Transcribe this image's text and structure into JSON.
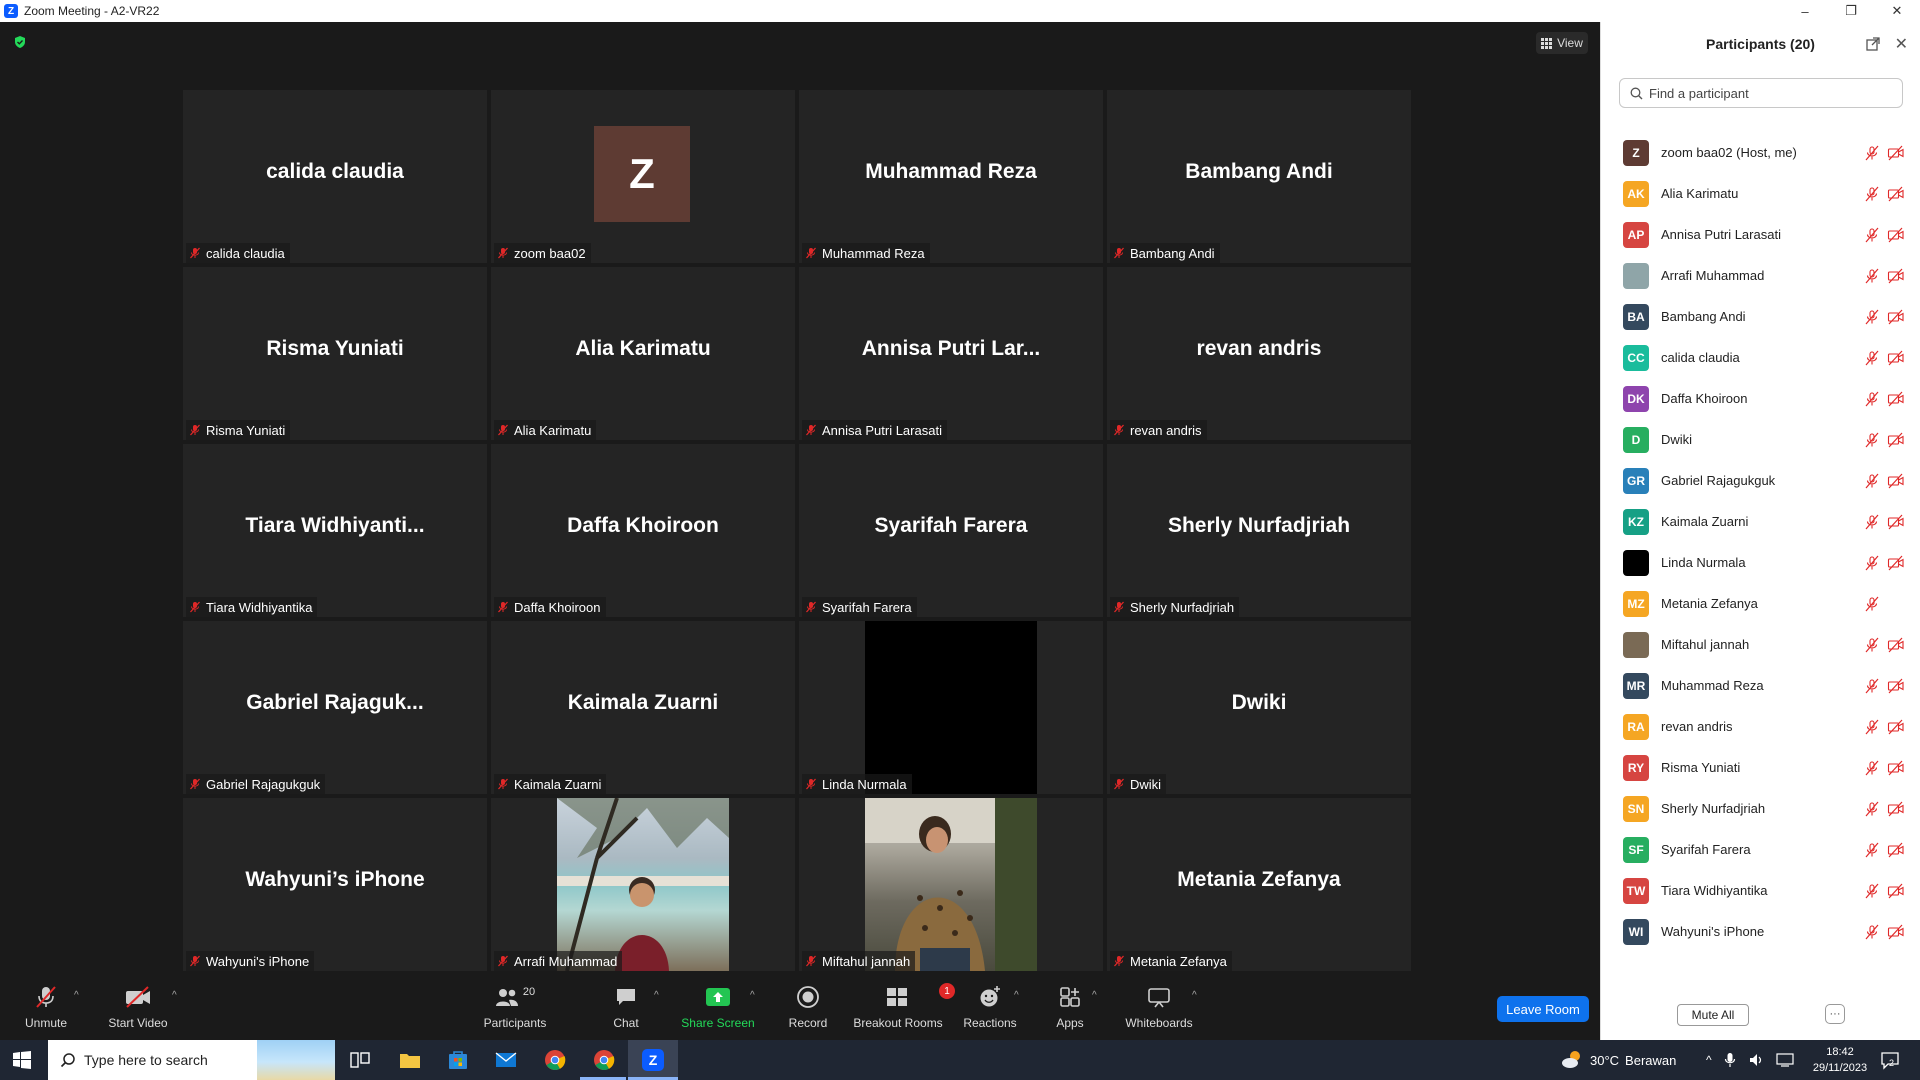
{
  "window": {
    "title": "Zoom Meeting - A2-VR22",
    "logo_letter": "Z",
    "controls": [
      "–",
      "❐",
      "✕"
    ]
  },
  "main": {
    "view_label": "View",
    "tiles": [
      {
        "big": "calida claudia",
        "label": "calida claudia",
        "kind": "name"
      },
      {
        "big": "",
        "label": "zoom baa02",
        "kind": "avatar",
        "avatar": "Z"
      },
      {
        "big": "Muhammad Reza",
        "label": "Muhammad Reza",
        "kind": "name"
      },
      {
        "big": "Bambang Andi",
        "label": "Bambang Andi",
        "kind": "name"
      },
      {
        "big": "Risma Yuniati",
        "label": "Risma Yuniati",
        "kind": "name"
      },
      {
        "big": "Alia Karimatu",
        "label": "Alia Karimatu",
        "kind": "name"
      },
      {
        "big": "Annisa  Putri  Lar...",
        "label": "Annisa Putri Larasati",
        "kind": "name"
      },
      {
        "big": "revan andris",
        "label": "revan andris",
        "kind": "name"
      },
      {
        "big": "Tiara  Widhiyanti...",
        "label": "Tiara Widhiyantika",
        "kind": "name"
      },
      {
        "big": "Daffa Khoiroon",
        "label": "Daffa Khoiroon",
        "kind": "name"
      },
      {
        "big": "Syarifah Farera",
        "label": "Syarifah Farera",
        "kind": "name"
      },
      {
        "big": "Sherly Nurfadjriah",
        "label": "Sherly Nurfadjriah",
        "kind": "name"
      },
      {
        "big": "Gabriel  Rajaguk...",
        "label": "Gabriel Rajagukguk",
        "kind": "name"
      },
      {
        "big": "Kaimala Zuarni",
        "label": "Kaimala Zuarni",
        "kind": "name"
      },
      {
        "big": "",
        "label": "Linda Nurmala",
        "kind": "black"
      },
      {
        "big": "Dwiki",
        "label": "Dwiki",
        "kind": "name"
      },
      {
        "big": "Wahyuni’s iPhone",
        "label": "Wahyuni's iPhone",
        "kind": "name"
      },
      {
        "big": "",
        "label": "Arrafi Muhammad",
        "kind": "photo-arrafi"
      },
      {
        "big": "",
        "label": "Miftahul jannah",
        "kind": "photo-mift"
      },
      {
        "big": "Metania Zefanya",
        "label": "Metania Zefanya",
        "kind": "name"
      }
    ]
  },
  "toolbar": {
    "unmute": "Unmute",
    "start_video": "Start Video",
    "participants": "Participants",
    "participants_count": "20",
    "chat": "Chat",
    "share_screen": "Share Screen",
    "record": "Record",
    "breakout_rooms": "Breakout Rooms",
    "breakout_badge": "1",
    "reactions": "Reactions",
    "apps": "Apps",
    "whiteboards": "Whiteboards",
    "leave_room": "Leave Room"
  },
  "panel": {
    "title": "Participants (20)",
    "search_placeholder": "Find a participant",
    "mute_all": "Mute All",
    "more": "···",
    "participants": [
      {
        "initials": "Z",
        "name": "zoom baa02 (Host, me)",
        "color": "#5e3b33",
        "cam": true
      },
      {
        "initials": "AK",
        "name": "Alia Karimatu",
        "color": "#f5a623",
        "cam": true
      },
      {
        "initials": "AP",
        "name": "Annisa Putri Larasati",
        "color": "#d64541",
        "cam": true
      },
      {
        "initials": "",
        "name": "Arrafi Muhammad",
        "color": "#8fa5a8",
        "cam": true
      },
      {
        "initials": "BA",
        "name": "Bambang Andi",
        "color": "#34495e",
        "cam": true
      },
      {
        "initials": "CC",
        "name": "calida claudia",
        "color": "#1abc9c",
        "cam": true
      },
      {
        "initials": "DK",
        "name": "Daffa Khoiroon",
        "color": "#8e44ad",
        "cam": true
      },
      {
        "initials": "D",
        "name": "Dwiki",
        "color": "#27ae60",
        "cam": true
      },
      {
        "initials": "GR",
        "name": "Gabriel Rajagukguk",
        "color": "#2980b9",
        "cam": true
      },
      {
        "initials": "KZ",
        "name": "Kaimala Zuarni",
        "color": "#16a085",
        "cam": true
      },
      {
        "initials": "",
        "name": "Linda Nurmala",
        "color": "#000000",
        "cam": true
      },
      {
        "initials": "MZ",
        "name": "Metania Zefanya",
        "color": "#f5a623",
        "cam": false
      },
      {
        "initials": "",
        "name": "Miftahul jannah",
        "color": "#7a6a55",
        "cam": true
      },
      {
        "initials": "MR",
        "name": "Muhammad Reza",
        "color": "#34495e",
        "cam": true
      },
      {
        "initials": "RA",
        "name": "revan andris",
        "color": "#f5a623",
        "cam": true
      },
      {
        "initials": "RY",
        "name": "Risma Yuniati",
        "color": "#d64541",
        "cam": true
      },
      {
        "initials": "SN",
        "name": "Sherly Nurfadjriah",
        "color": "#f5a623",
        "cam": true
      },
      {
        "initials": "SF",
        "name": "Syarifah Farera",
        "color": "#27ae60",
        "cam": true
      },
      {
        "initials": "TW",
        "name": "Tiara Widhiyantika",
        "color": "#d64541",
        "cam": true
      },
      {
        "initials": "WI",
        "name": "Wahyuni's iPhone",
        "color": "#34495e",
        "cam": true
      }
    ]
  },
  "taskbar": {
    "search_placeholder": "Type here to search",
    "weather_temp": "30°C",
    "weather_text": "Berawan",
    "time": "18:42",
    "date": "29/11/2023",
    "notif_count": "2"
  }
}
